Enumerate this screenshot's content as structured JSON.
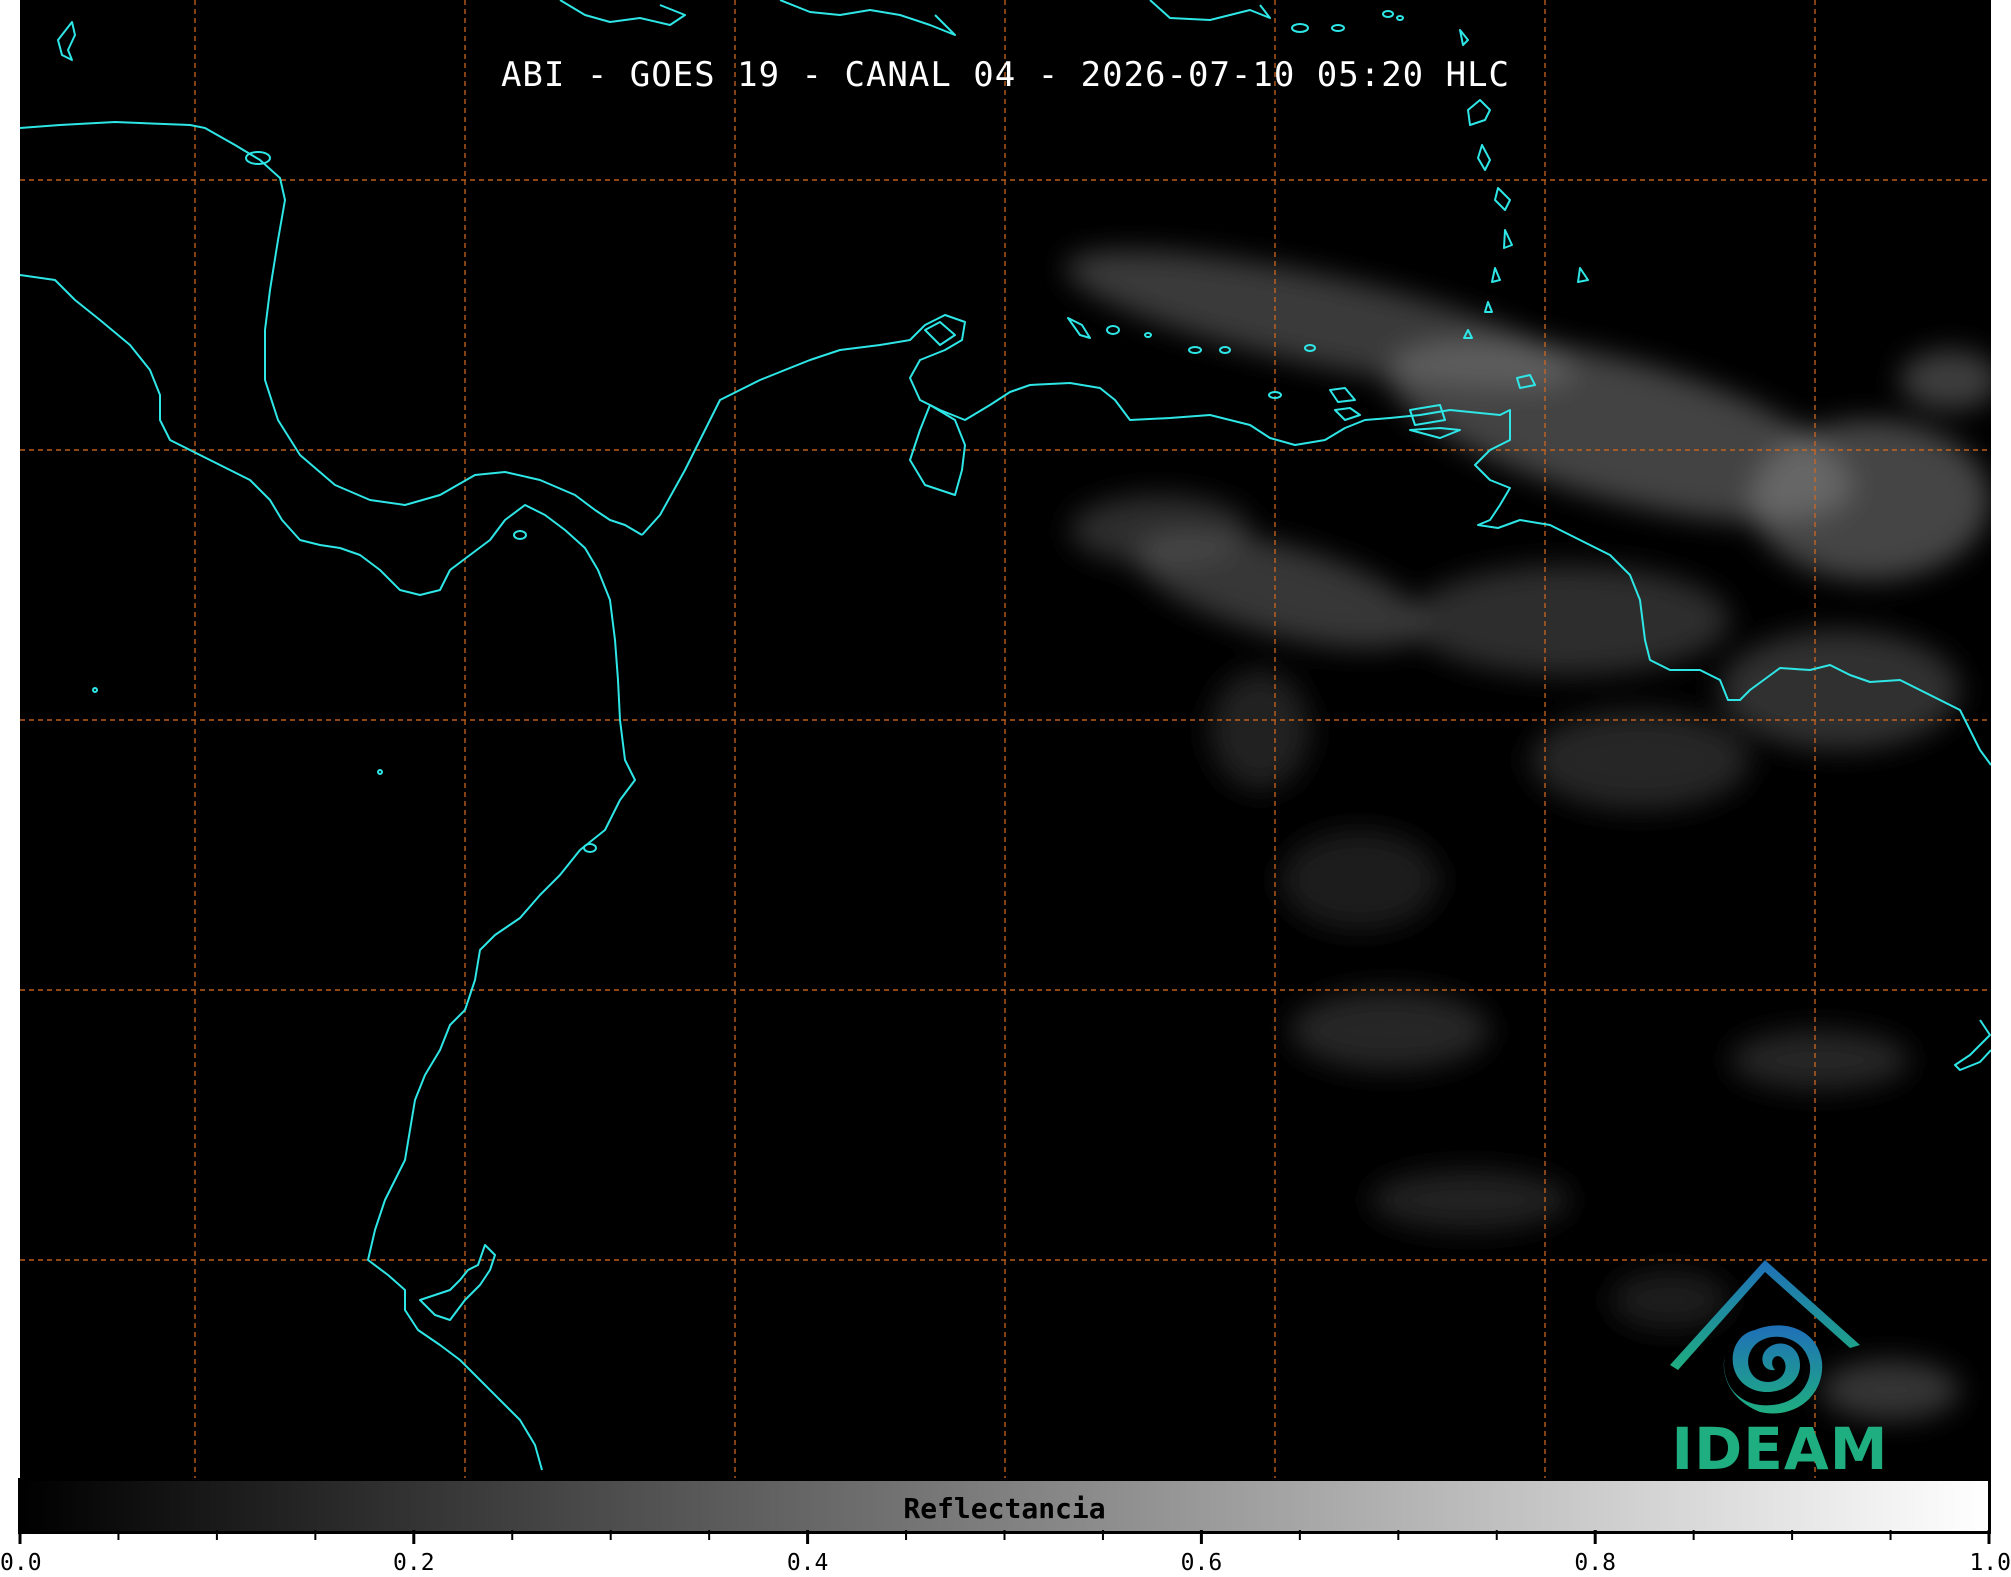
{
  "title": "ABI - GOES 19 - CANAL 04 - 2026-07-10 05:20 HLC",
  "colors": {
    "background": "#000000",
    "coastline": "#2ee6e6",
    "graticule": "#d2691e",
    "logo_blue": "#1f6fb8",
    "logo_teal": "#1fae80"
  },
  "logo": {
    "text": "IDEAM"
  },
  "colorbar": {
    "label": "Reflectancia",
    "min": 0.0,
    "max": 1.0,
    "ticks": [
      "0.0",
      "0.2",
      "0.4",
      "0.6",
      "0.8",
      "1.0"
    ],
    "tick_values": [
      0.0,
      0.2,
      0.4,
      0.6,
      0.8,
      1.0
    ],
    "minor_step": 0.05,
    "colormap": "gray"
  }
}
